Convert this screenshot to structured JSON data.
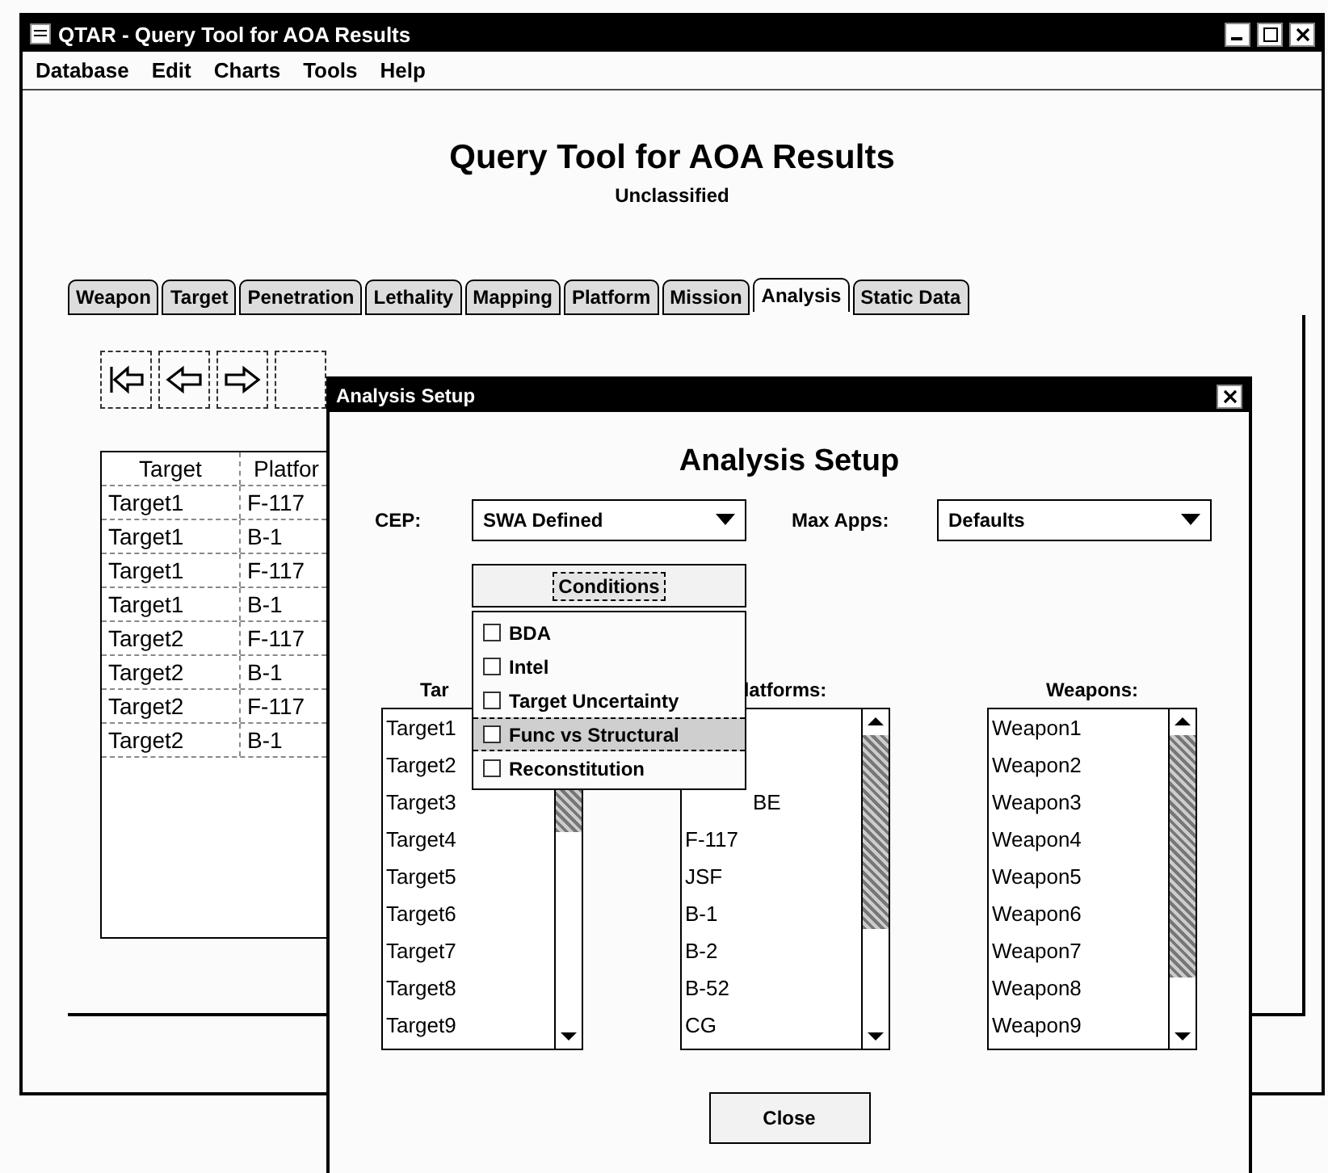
{
  "window": {
    "title": "QTAR - Query Tool for AOA Results"
  },
  "menu": [
    "Database",
    "Edit",
    "Charts",
    "Tools",
    "Help"
  ],
  "header": {
    "title": "Query Tool for AOA Results",
    "classification": "Unclassified"
  },
  "tabs": [
    {
      "label": "Weapon",
      "selected": false
    },
    {
      "label": "Target",
      "selected": false
    },
    {
      "label": "Penetration",
      "selected": false
    },
    {
      "label": "Lethality",
      "selected": false
    },
    {
      "label": "Mapping",
      "selected": false
    },
    {
      "label": "Platform",
      "selected": false
    },
    {
      "label": "Mission",
      "selected": false
    },
    {
      "label": "Analysis",
      "selected": true
    },
    {
      "label": "Static Data",
      "selected": false
    }
  ],
  "toolbar": [
    {
      "kind": "first"
    },
    {
      "kind": "prev"
    },
    {
      "kind": "next"
    },
    {
      "kind": "blank"
    }
  ],
  "results_table": {
    "columns": [
      "Target",
      "Platfor"
    ],
    "rows": [
      [
        "Target1",
        "F-117"
      ],
      [
        "Target1",
        "B-1"
      ],
      [
        "Target1",
        "F-117"
      ],
      [
        "Target1",
        "B-1"
      ],
      [
        "Target2",
        "F-117"
      ],
      [
        "Target2",
        "B-1"
      ],
      [
        "Target2",
        "F-117"
      ],
      [
        "Target2",
        "B-1"
      ]
    ]
  },
  "dialog": {
    "title": "Analysis Setup",
    "heading": "Analysis Setup",
    "cep": {
      "label": "CEP:",
      "value": "SWA Defined"
    },
    "max_apps": {
      "label": "Max Apps:",
      "value": "Defaults"
    },
    "conditions": {
      "label": "Conditions",
      "expanded": true,
      "items": [
        {
          "label": "BDA",
          "checked": false,
          "selected": false
        },
        {
          "label": "Intel",
          "checked": false,
          "selected": false
        },
        {
          "label": "Target Uncertainty",
          "checked": false,
          "selected": false
        },
        {
          "label": "Func vs Structural",
          "checked": false,
          "selected": true
        },
        {
          "label": "Reconstitution",
          "checked": false,
          "selected": false
        }
      ]
    },
    "lists": [
      {
        "kind": "targets",
        "label": "Tar",
        "items": [
          "Target1",
          "Target2",
          "Target3",
          "Target4",
          "Target5",
          "Target6",
          "Target7",
          "Target8",
          "Target9"
        ]
      },
      {
        "kind": "platforms",
        "label": "latforms:",
        "items": [
          "BE",
          "F-117",
          "JSF",
          "B-1",
          "B-2",
          "B-52",
          "CG"
        ]
      },
      {
        "kind": "weapons",
        "label": "Weapons:",
        "items": [
          "Weapon1",
          "Weapon2",
          "Weapon3",
          "Weapon4",
          "Weapon5",
          "Weapon6",
          "Weapon7",
          "Weapon8",
          "Weapon9"
        ]
      }
    ],
    "close": "Close"
  }
}
